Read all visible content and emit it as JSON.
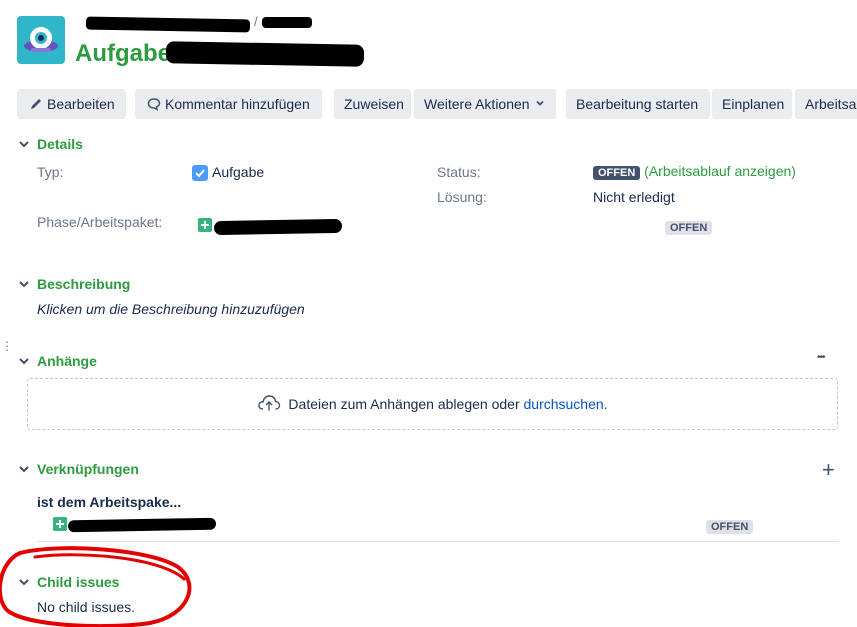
{
  "header": {
    "breadcrumb_separator": "/",
    "title": "Aufgabe"
  },
  "toolbar": {
    "edit": "Bearbeiten",
    "comment": "Kommentar hinzufügen",
    "assign": "Zuweisen",
    "more": "Weitere Aktionen",
    "start_progress": "Bearbeitung starten",
    "schedule": "Einplanen",
    "workflow_partial": "Arbeitsablauf"
  },
  "details": {
    "heading": "Details",
    "type_label": "Typ:",
    "type_value": "Aufgabe",
    "status_label": "Status:",
    "status_value": "OFFEN",
    "workflow_link": "Arbeitsablauf anzeigen",
    "resolution_label": "Lösung:",
    "resolution_value": "Nicht erledigt",
    "phase_label": "Phase/Arbeitspaket:",
    "phase_status": "OFFEN"
  },
  "description": {
    "heading": "Beschreibung",
    "placeholder": "Klicken um die Beschreibung hinzuzufügen"
  },
  "attachments": {
    "heading": "Anhänge",
    "more": "•••",
    "drop_text": "Dateien zum Anhängen ablegen oder",
    "browse_link": "durchsuchen."
  },
  "links": {
    "heading": "Verknüpfungen",
    "add": "+",
    "relation": "ist dem Arbeitspake...",
    "item_status": "OFFEN"
  },
  "child_issues": {
    "heading": "Child issues",
    "empty": "No child issues."
  },
  "colors": {
    "green": "#2d9b3f",
    "dark_lozenge": "#42526e",
    "annotation_red": "#e30000"
  }
}
